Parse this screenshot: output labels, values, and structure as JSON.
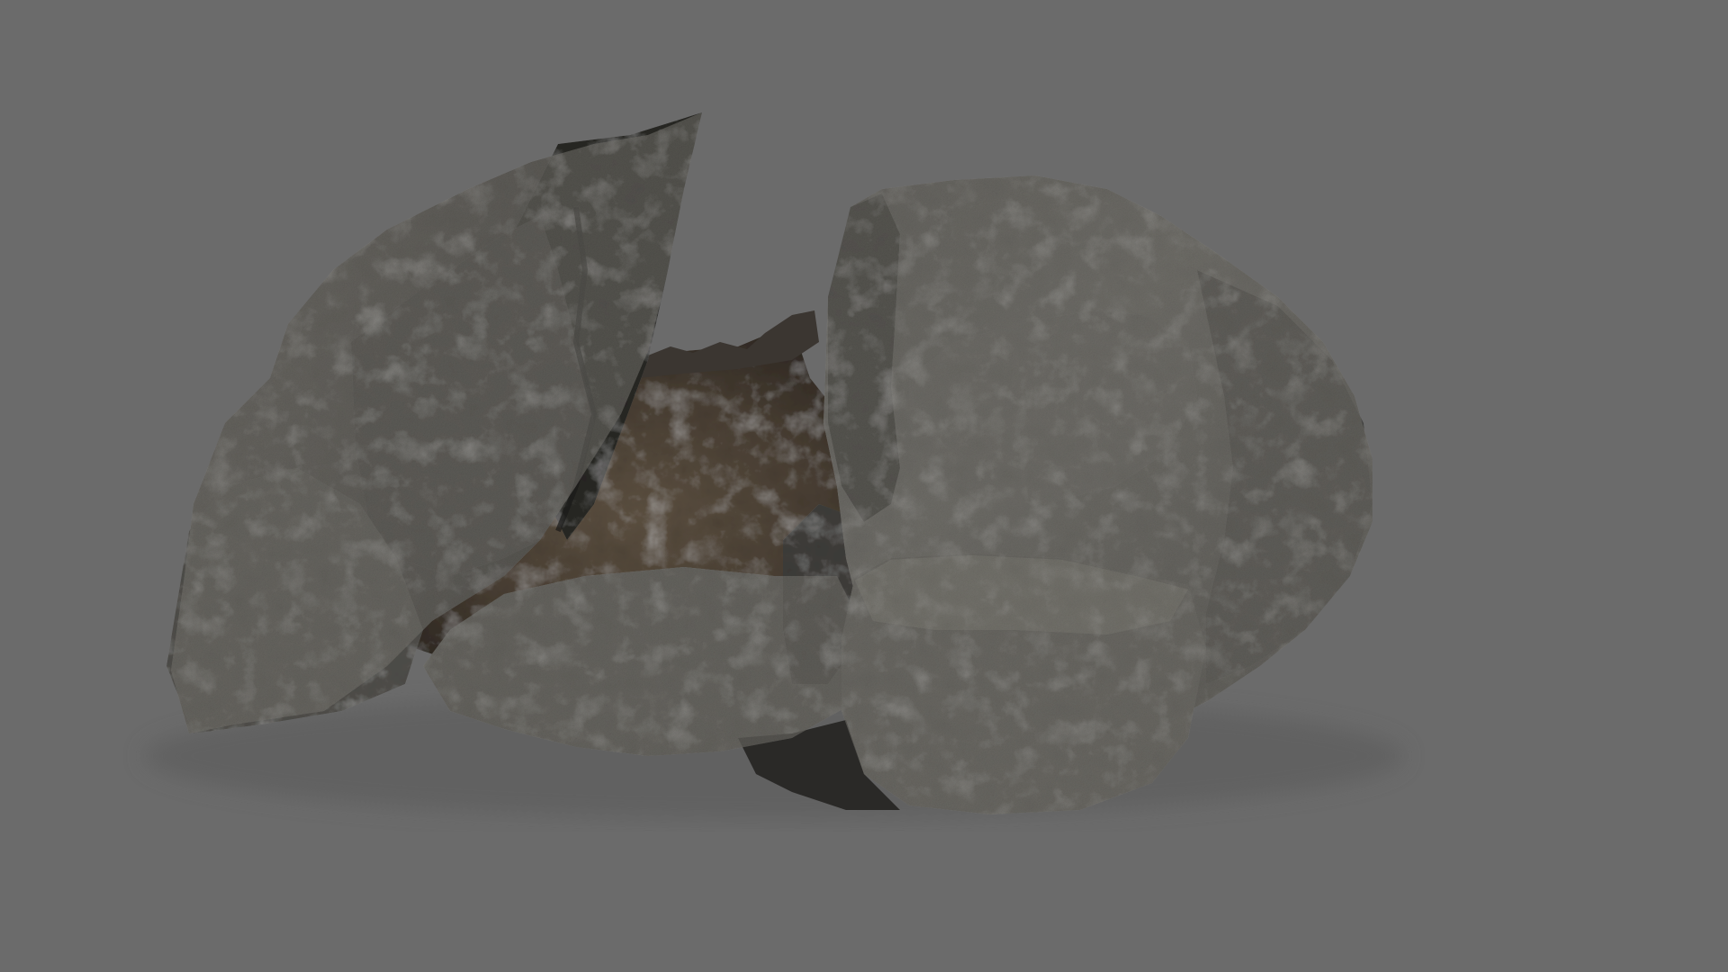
{
  "scene": {
    "background_color": "#6b6b6b",
    "subject": "rock-formation-3d-model",
    "palette": {
      "rock_light": "#5c5b58",
      "rock_mid": "#484744",
      "rock_dark": "#2f2e2c",
      "rock_shadow": "#1e1d1c",
      "rock_highlight": "#77756f",
      "dirt_light": "#6b5e4c",
      "dirt_mid": "#52473a",
      "dirt_dark": "#3a3229",
      "ground_shadow": "#5f5f5f"
    }
  }
}
